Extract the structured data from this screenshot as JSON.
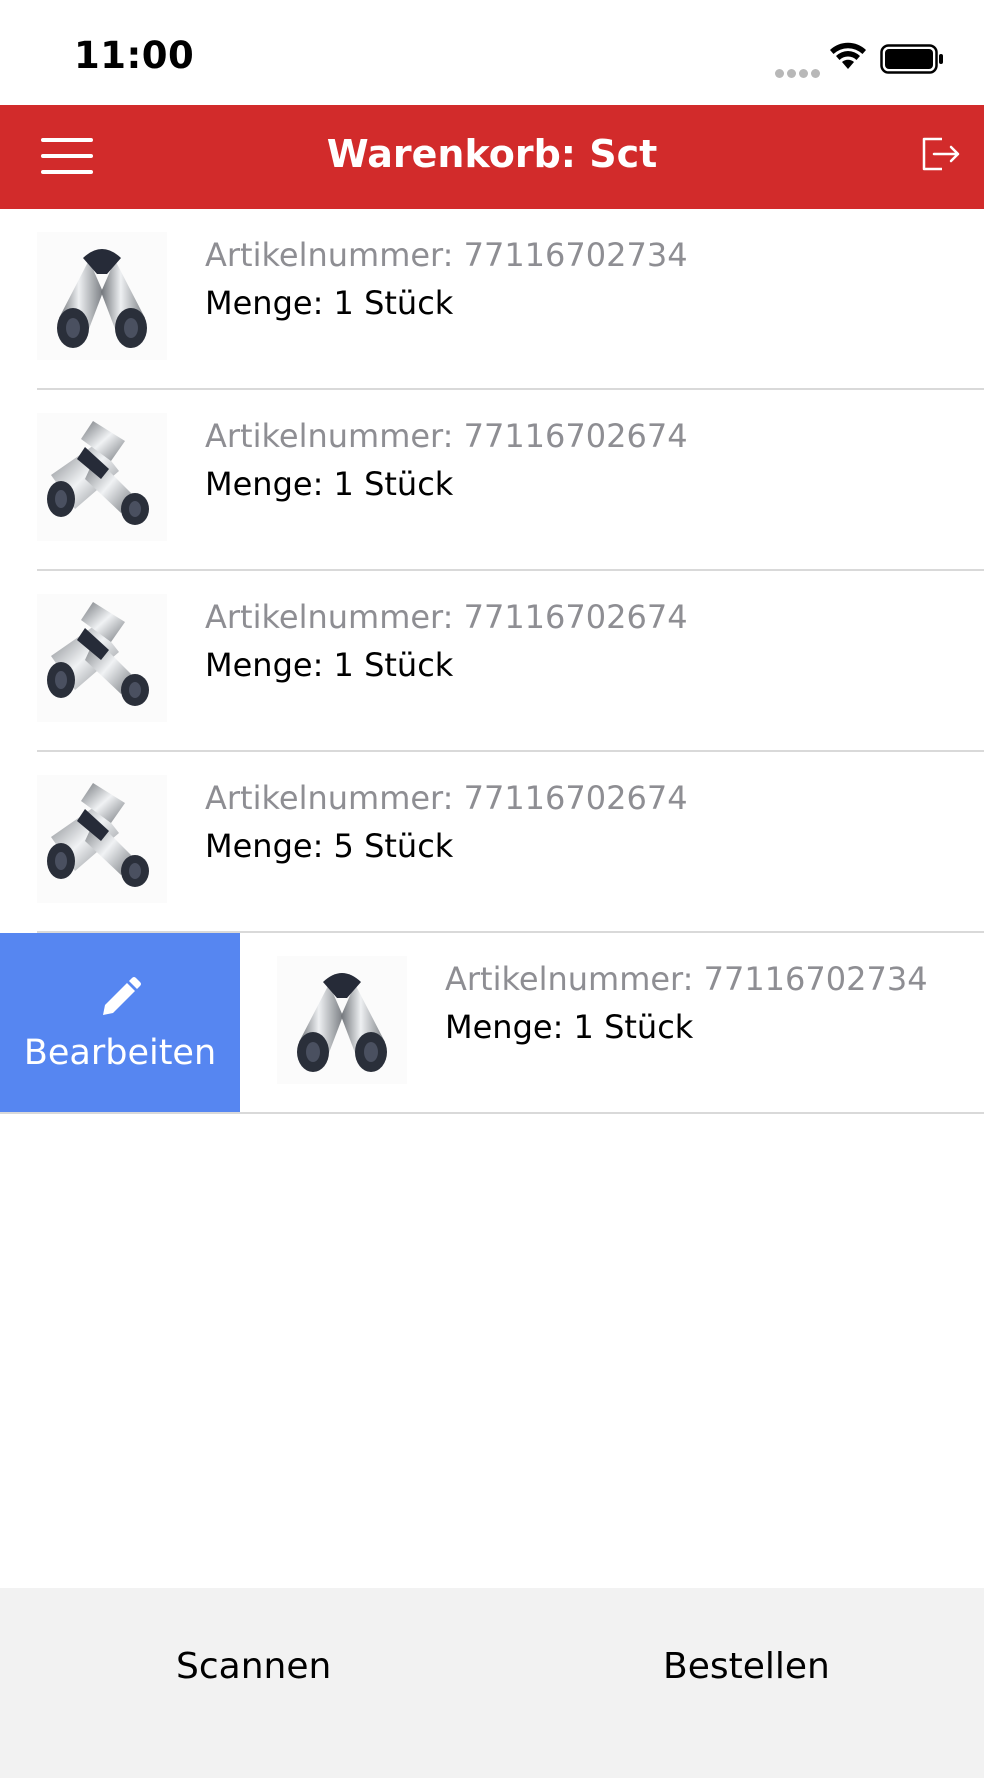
{
  "status": {
    "time": "11:00"
  },
  "nav": {
    "title": "Warenkorb: Sct"
  },
  "items": [
    {
      "article": "Artikelnummer: 77116702734",
      "quantity": "Menge: 1 Stück",
      "image": "elbow-fitting"
    },
    {
      "article": "Artikelnummer: 77116702674",
      "quantity": "Menge: 1 Stück",
      "image": "tee-fitting"
    },
    {
      "article": "Artikelnummer: 77116702674",
      "quantity": "Menge: 1 Stück",
      "image": "tee-fitting"
    },
    {
      "article": "Artikelnummer: 77116702674",
      "quantity": "Menge: 5 Stück",
      "image": "tee-fitting"
    },
    {
      "article": "Artikelnummer: 77116702734",
      "quantity": "Menge: 1 Stück",
      "image": "elbow-fitting"
    }
  ],
  "swipe_action": {
    "label": "Bearbeiten",
    "icon": "pencil-icon",
    "color": "#5686f1"
  },
  "toolbar": {
    "scan_label": "Scannen",
    "order_label": "Bestellen"
  },
  "colors": {
    "navbar": "#d22b2b",
    "toolbar": "#f2f2f2"
  }
}
